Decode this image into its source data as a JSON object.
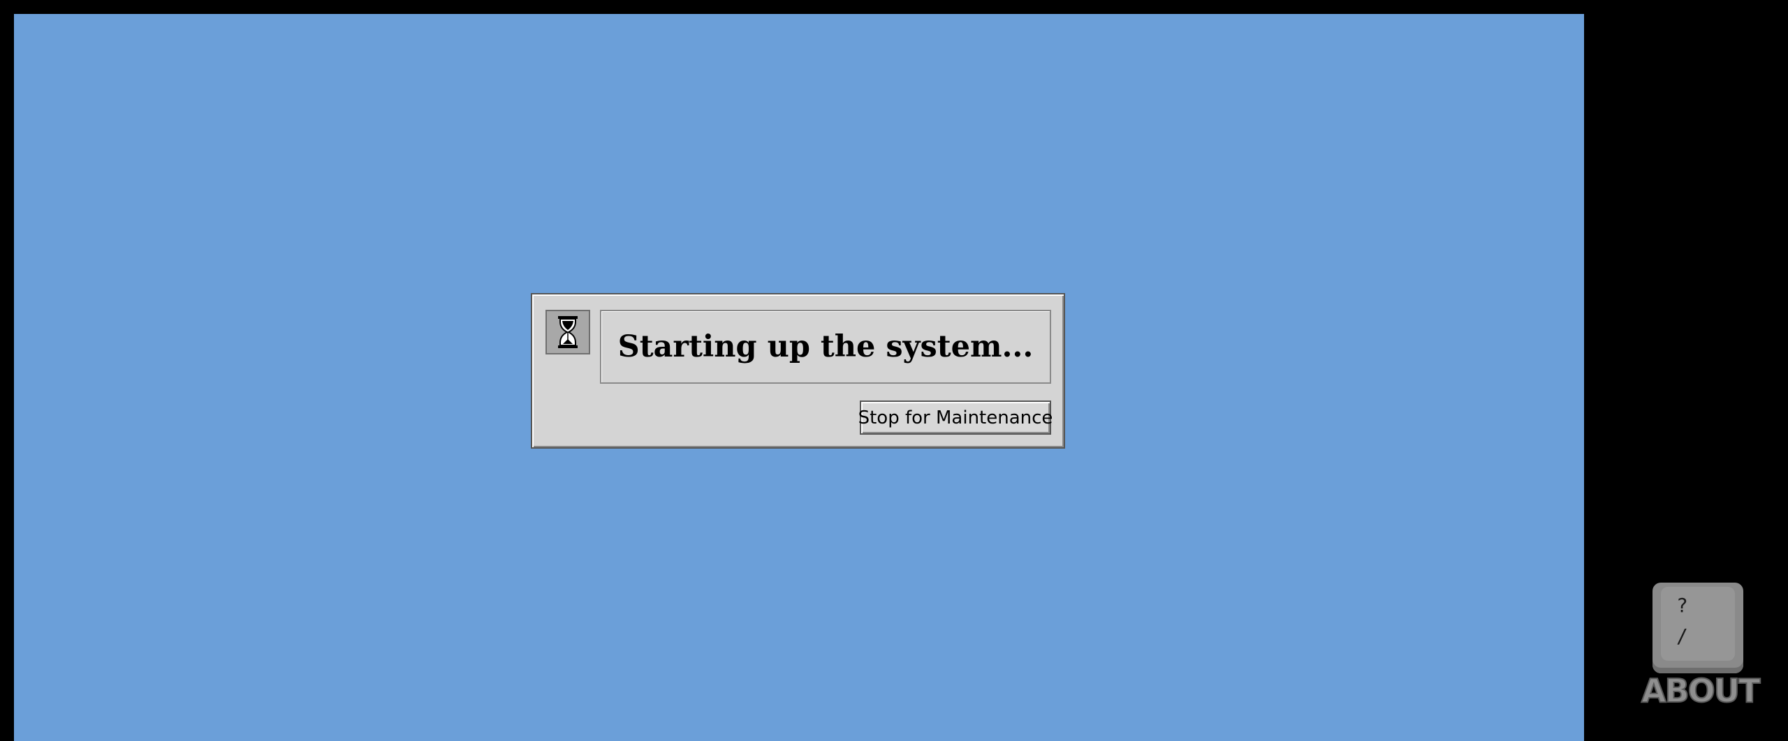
{
  "dialog": {
    "message": "Starting up the system...",
    "maintenance_button_label": "Stop for Maintenance",
    "icon": "hourglass-icon"
  },
  "about": {
    "key_upper": "?",
    "key_lower": "/",
    "label": "ABOUT"
  },
  "colors": {
    "desktop": "#6b9fd9",
    "outer": "#000000",
    "dialog_face": "#d4d4d4"
  }
}
